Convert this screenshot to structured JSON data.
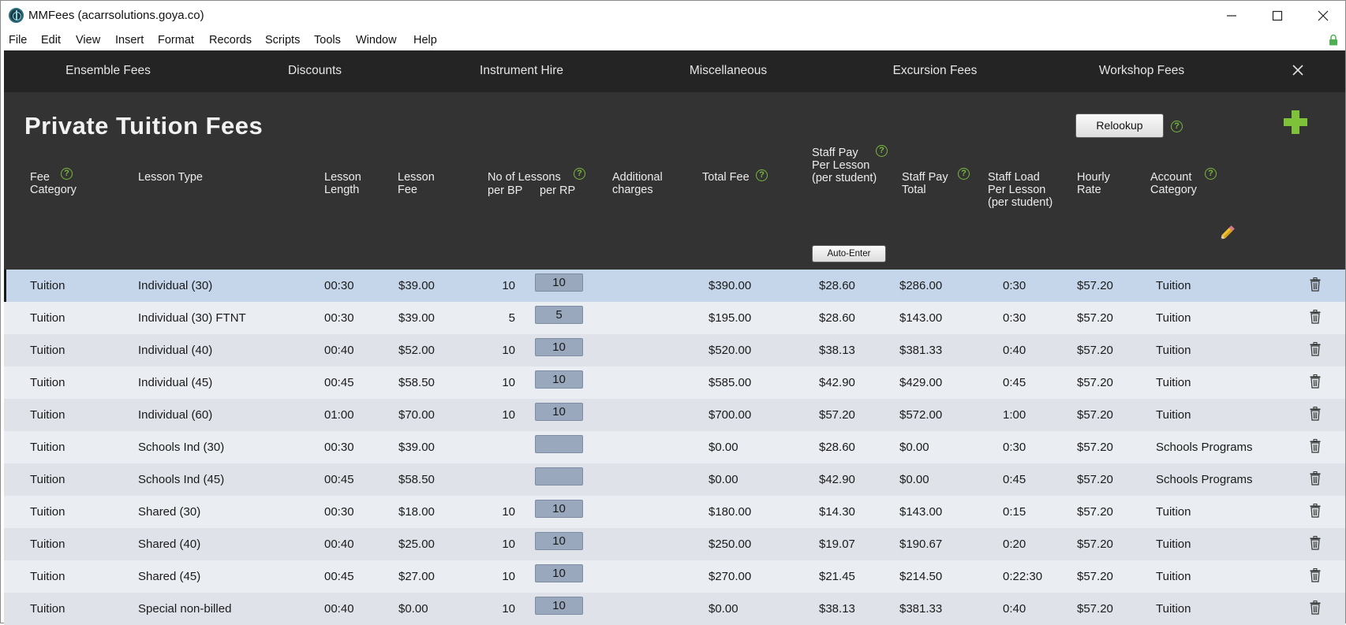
{
  "window": {
    "title": "MMFees (acarrsolutions.goya.co)",
    "controls": {
      "minimize": "—",
      "maximize": "☐",
      "close": "✕"
    }
  },
  "menu": [
    "File",
    "Edit",
    "View",
    "Insert",
    "Format",
    "Records",
    "Scripts",
    "Tools",
    "Window",
    "Help"
  ],
  "tabs": [
    "Ensemble Fees",
    "Discounts",
    "Instrument Hire",
    "Miscellaneous",
    "Excursion Fees",
    "Workshop Fees"
  ],
  "page": {
    "title": "Private Tuition Fees",
    "relookup_label": "Relookup",
    "auto_enter_label": "Auto-Enter",
    "help_glyph": "?"
  },
  "columns": {
    "fee_category": [
      "Fee",
      "Category"
    ],
    "lesson_type": [
      "Lesson Type"
    ],
    "lesson_length": [
      "Lesson",
      "Length"
    ],
    "lesson_fee": [
      "Lesson",
      "Fee"
    ],
    "no_of_lessons": [
      "No of Lessons"
    ],
    "per_bp": "per BP",
    "per_rp": "per RP",
    "additional_charges": [
      "Additional",
      "charges"
    ],
    "total_fee": [
      "Total Fee"
    ],
    "staff_pay_per_lesson": [
      "Staff Pay",
      "Per Lesson",
      "(per student)"
    ],
    "staff_pay_total": [
      "Staff Pay",
      "Total"
    ],
    "staff_load": [
      "Staff Load",
      "Per Lesson",
      "(per student)"
    ],
    "hourly_rate": [
      "Hourly",
      "Rate"
    ],
    "account_category": [
      "Account",
      "Category"
    ]
  },
  "rows": [
    {
      "fee_category": "Tuition",
      "lesson_type": "Individual (30)",
      "length": "00:30",
      "fee": "$39.00",
      "per_bp": "10",
      "per_rp": "10",
      "additional": "",
      "total_fee": "$390.00",
      "staff_pay": "$28.60",
      "staff_total": "$286.00",
      "staff_load": "0:30",
      "hourly": "$57.20",
      "account": "Tuition",
      "selected": true
    },
    {
      "fee_category": "Tuition",
      "lesson_type": "Individual (30) FTNT",
      "length": "00:30",
      "fee": "$39.00",
      "per_bp": "5",
      "per_rp": "5",
      "additional": "",
      "total_fee": "$195.00",
      "staff_pay": "$28.60",
      "staff_total": "$143.00",
      "staff_load": "0:30",
      "hourly": "$57.20",
      "account": "Tuition"
    },
    {
      "fee_category": "Tuition",
      "lesson_type": "Individual (40)",
      "length": "00:40",
      "fee": "$52.00",
      "per_bp": "10",
      "per_rp": "10",
      "additional": "",
      "total_fee": "$520.00",
      "staff_pay": "$38.13",
      "staff_total": "$381.33",
      "staff_load": "0:40",
      "hourly": "$57.20",
      "account": "Tuition"
    },
    {
      "fee_category": "Tuition",
      "lesson_type": "Individual (45)",
      "length": "00:45",
      "fee": "$58.50",
      "per_bp": "10",
      "per_rp": "10",
      "additional": "",
      "total_fee": "$585.00",
      "staff_pay": "$42.90",
      "staff_total": "$429.00",
      "staff_load": "0:45",
      "hourly": "$57.20",
      "account": "Tuition"
    },
    {
      "fee_category": "Tuition",
      "lesson_type": "Individual (60)",
      "length": "01:00",
      "fee": "$70.00",
      "per_bp": "10",
      "per_rp": "10",
      "additional": "",
      "total_fee": "$700.00",
      "staff_pay": "$57.20",
      "staff_total": "$572.00",
      "staff_load": "1:00",
      "hourly": "$57.20",
      "account": "Tuition"
    },
    {
      "fee_category": "Tuition",
      "lesson_type": "Schools Ind (30)",
      "length": "00:30",
      "fee": "$39.00",
      "per_bp": "",
      "per_rp": "",
      "additional": "",
      "total_fee": "$0.00",
      "staff_pay": "$28.60",
      "staff_total": "$0.00",
      "staff_load": "0:30",
      "hourly": "$57.20",
      "account": "Schools Programs"
    },
    {
      "fee_category": "Tuition",
      "lesson_type": "Schools Ind (45)",
      "length": "00:45",
      "fee": "$58.50",
      "per_bp": "",
      "per_rp": "",
      "additional": "",
      "total_fee": "$0.00",
      "staff_pay": "$42.90",
      "staff_total": "$0.00",
      "staff_load": "0:45",
      "hourly": "$57.20",
      "account": "Schools Programs"
    },
    {
      "fee_category": "Tuition",
      "lesson_type": "Shared (30)",
      "length": "00:30",
      "fee": "$18.00",
      "per_bp": "10",
      "per_rp": "10",
      "additional": "",
      "total_fee": "$180.00",
      "staff_pay": "$14.30",
      "staff_total": "$143.00",
      "staff_load": "0:15",
      "hourly": "$57.20",
      "account": "Tuition"
    },
    {
      "fee_category": "Tuition",
      "lesson_type": "Shared (40)",
      "length": "00:40",
      "fee": "$25.00",
      "per_bp": "10",
      "per_rp": "10",
      "additional": "",
      "total_fee": "$250.00",
      "staff_pay": "$19.07",
      "staff_total": "$190.67",
      "staff_load": "0:20",
      "hourly": "$57.20",
      "account": "Tuition"
    },
    {
      "fee_category": "Tuition",
      "lesson_type": "Shared (45)",
      "length": "00:45",
      "fee": "$27.00",
      "per_bp": "10",
      "per_rp": "10",
      "additional": "",
      "total_fee": "$270.00",
      "staff_pay": "$21.45",
      "staff_total": "$214.50",
      "staff_load": "0:22:30",
      "hourly": "$57.20",
      "account": "Tuition"
    },
    {
      "fee_category": "Tuition",
      "lesson_type": "Special non-billed",
      "length": "00:40",
      "fee": "$0.00",
      "per_bp": "10",
      "per_rp": "10",
      "additional": "",
      "total_fee": "$0.00",
      "staff_pay": "$38.13",
      "staff_total": "$381.33",
      "staff_load": "0:40",
      "hourly": "$57.20",
      "account": "Tuition"
    }
  ],
  "colors": {
    "tabbar_bg": "#242424",
    "header_bg": "#333333",
    "row_selected": "#c6d6ea",
    "row_light": "#eaedf1",
    "row_dark": "#dfe3e9",
    "rp_box": "#9aa8bd",
    "accent_green": "#7ec23a"
  },
  "icons": {
    "app": "mmfees-app-icon",
    "add": "plus-icon",
    "edit": "pencil-icon",
    "delete": "trash-icon",
    "close_panel": "close-icon",
    "help": "help-icon",
    "lock": "lock-icon"
  }
}
